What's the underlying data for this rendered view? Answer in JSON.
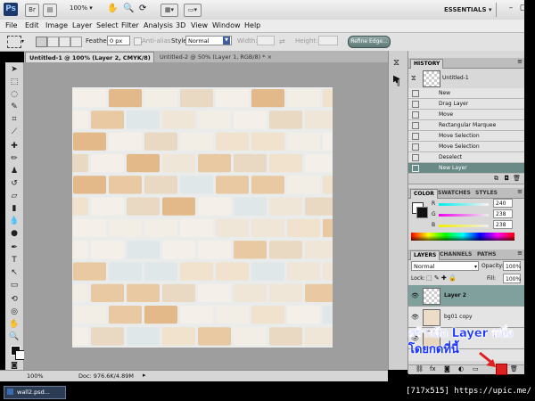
{
  "app": {
    "logo": "Ps",
    "zoom": "100%",
    "workspace": "ESSENTIALS",
    "workspace_caret": "▾"
  },
  "toolbar_icons": [
    "bridge-icon",
    "mini-bridge-icon",
    "zoom-select",
    "hand-icon",
    "zoom-icon",
    "rotate-icon",
    "arrange-icon",
    "screen-mode-icon"
  ],
  "menu": [
    "File",
    "Edit",
    "Image",
    "Layer",
    "Select",
    "Filter",
    "Analysis",
    "3D",
    "View",
    "Window",
    "Help"
  ],
  "options": {
    "feather_label": "Feather:",
    "feather_value": "0 px",
    "antialias_label": "Anti-alias",
    "style_label": "Style:",
    "style_value": "Normal",
    "width_label": "Width:",
    "height_label": "Height:",
    "refine_label": "Refine Edge..."
  },
  "tabs": [
    {
      "label": "Untitled-1 @ 100% (Layer 2, CMYK/8) *",
      "close": "×"
    },
    {
      "label": "Untitled-2 @ 50% (Layer 1, RGB/8) *",
      "close": "×"
    }
  ],
  "status": {
    "zoom": "100%",
    "doc": "Doc: 976.6K/4.89M"
  },
  "history": {
    "title": "HISTORY",
    "snapshot": "Untitled-1",
    "items": [
      "New",
      "Drag Layer",
      "Move",
      "Rectangular Marquee",
      "Move Selection",
      "Move Selection",
      "Deselect",
      "New Layer"
    ]
  },
  "color_panel": {
    "tabs": [
      "COLOR",
      "SWATCHES",
      "STYLES"
    ],
    "r_label": "R",
    "r_value": "240",
    "g_label": "G",
    "g_value": "238",
    "b_label": "B",
    "b_value": "238"
  },
  "layers_panel": {
    "tabs": [
      "LAYERS",
      "CHANNELS",
      "PATHS"
    ],
    "blend_mode": "Normal",
    "opacity_label": "Opacity:",
    "opacity_value": "100%",
    "lock_label": "Lock:",
    "fill_label": "Fill:",
    "fill_value": "100%",
    "layers": [
      "Layer 2",
      "bg01 copy",
      ""
    ]
  },
  "annotation": {
    "line1": "สร้างอีก Layer หนึ่ง",
    "line2": "โดยกดที่นี้"
  },
  "taskbar": {
    "item": "wall2.psd...",
    "watermark": "[717x515] https://upic.me/"
  },
  "colors": {
    "accent": "#6a8a87",
    "annotation": "#1a35ff",
    "new_layer_button": "#e02020"
  }
}
